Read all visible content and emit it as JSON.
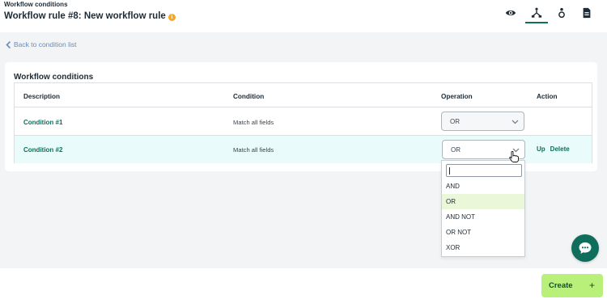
{
  "header": {
    "breadcrumb": "Workflow conditions",
    "title": "Workflow rule #8: New workflow rule",
    "info_icon": "info-icon",
    "icons": [
      "eye-icon",
      "workflow-icon",
      "person-icon",
      "document-icon"
    ]
  },
  "back_link": "Back to condition list",
  "card": {
    "title": "Workflow conditions",
    "columns": [
      "Description",
      "Condition",
      "Operation",
      "Action"
    ],
    "rows": [
      {
        "description": "Condition #1",
        "condition": "Match all fields",
        "operation": "OR",
        "actions": []
      },
      {
        "description": "Condition #2",
        "condition": "Match all fields",
        "operation": "OR",
        "actions": [
          "Up",
          "Delete"
        ]
      }
    ]
  },
  "dropdown": {
    "search_value": "",
    "options": [
      "AND",
      "OR",
      "AND NOT",
      "OR NOT",
      "XOR"
    ],
    "selected": "OR"
  },
  "create_label": "Create",
  "create_icon": "+",
  "colors": {
    "accent": "#0f6e5b",
    "create_bg": "#b9f07a",
    "selected_row": "#e9fbfa",
    "selected_option": "#eaf8d9",
    "info": "#f5a623"
  }
}
